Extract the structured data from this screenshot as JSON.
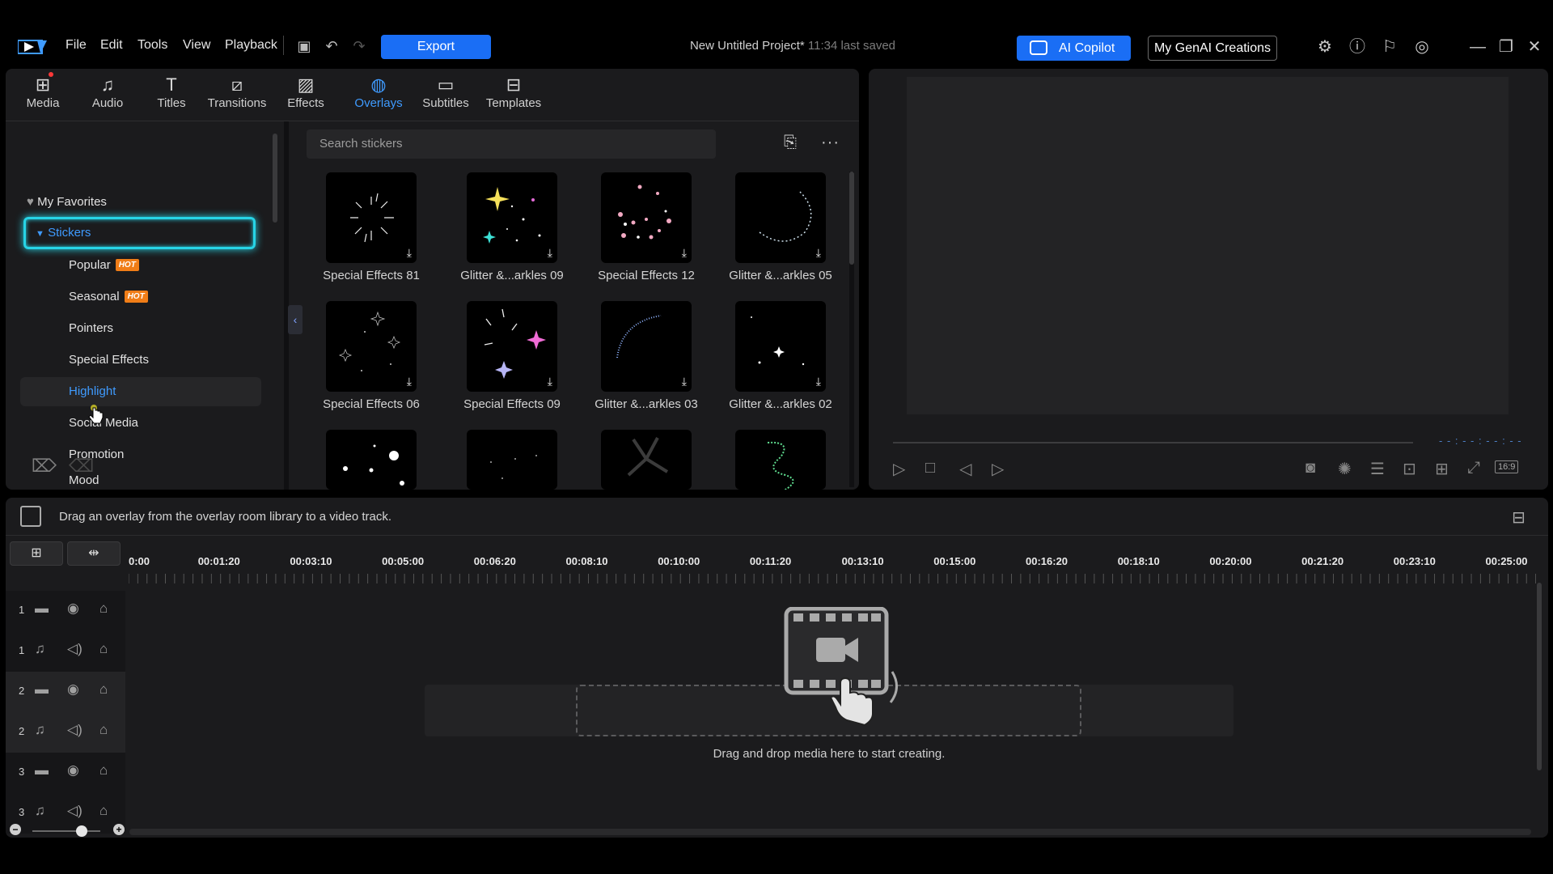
{
  "menu": [
    "File",
    "Edit",
    "Tools",
    "View",
    "Playback"
  ],
  "export_label": "Export",
  "project": {
    "title": "New Untitled Project*",
    "saved": "11:34 last saved"
  },
  "ai_copilot_label": "AI Copilot",
  "genai_label": "My GenAI Creations",
  "tabs": [
    {
      "label": "Media",
      "icon": "media-icon"
    },
    {
      "label": "Audio",
      "icon": "audio-icon"
    },
    {
      "label": "Titles",
      "icon": "titles-icon"
    },
    {
      "label": "Transitions",
      "icon": "transitions-icon"
    },
    {
      "label": "Effects",
      "icon": "effects-icon"
    },
    {
      "label": "Overlays",
      "icon": "overlays-icon",
      "active": true
    },
    {
      "label": "Subtitles",
      "icon": "subtitles-icon"
    },
    {
      "label": "Templates",
      "icon": "templates-icon"
    }
  ],
  "tree": {
    "favorites": "My Favorites",
    "stickers": "Stickers",
    "items": [
      "Popular",
      "Seasonal",
      "Pointers",
      "Special Effects",
      "Highlight",
      "Social Media",
      "Promotion",
      "Mood"
    ],
    "hot_badge": "HOT"
  },
  "search": {
    "placeholder": "Search stickers"
  },
  "stickers": [
    "Special Effects 81",
    "Glitter &...arkles 09",
    "Special Effects 12",
    "Glitter &...arkles 05",
    "Special Effects 06",
    "Special Effects 09",
    "Glitter &...arkles 03",
    "Glitter &...arkles 02"
  ],
  "preview": {
    "timecode": "- - : - - : - - : - -",
    "aspect": "16:9"
  },
  "timeline": {
    "hint": "Drag an overlay from the overlay room library to a video track.",
    "ruler": [
      "0:00",
      "00:01:20",
      "00:03:10",
      "00:05:00",
      "00:06:20",
      "00:08:10",
      "00:10:00",
      "00:11:20",
      "00:13:10",
      "00:15:00",
      "00:16:20",
      "00:18:10",
      "00:20:00",
      "00:21:20",
      "00:23:10",
      "00:25:00"
    ],
    "tracks": [
      {
        "num": "1",
        "type": "video"
      },
      {
        "num": "1",
        "type": "audio"
      },
      {
        "num": "2",
        "type": "video"
      },
      {
        "num": "2",
        "type": "audio"
      },
      {
        "num": "3",
        "type": "video"
      },
      {
        "num": "3",
        "type": "audio"
      }
    ],
    "drop_text": "Drag and drop media here to start creating."
  },
  "colors": {
    "accent": "#1a6ef5",
    "active_tab": "#3f9bff",
    "highlight_border": "#27d4e6",
    "hot": "#f07d17"
  }
}
